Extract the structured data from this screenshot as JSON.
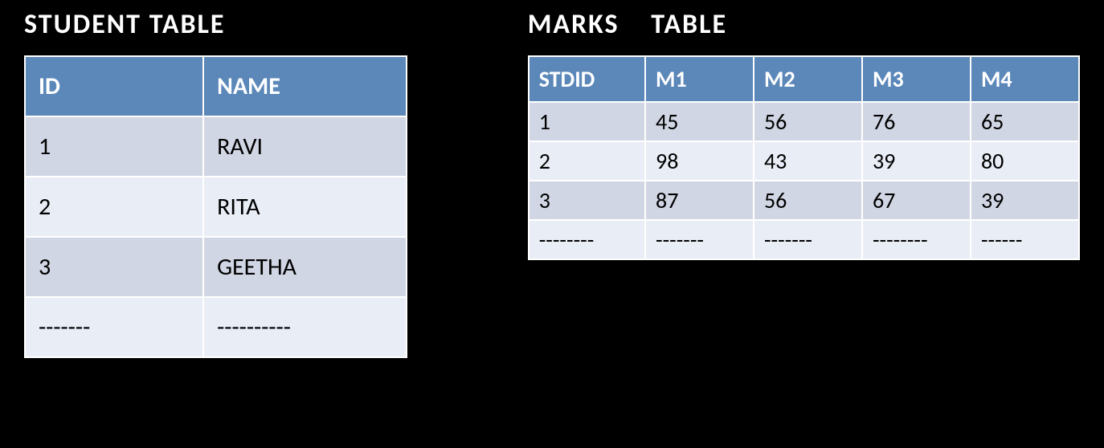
{
  "student_table": {
    "title": "STUDENT  TABLE",
    "headers": [
      "ID",
      "NAME"
    ],
    "rows": [
      [
        "1",
        "RAVI"
      ],
      [
        "2",
        "RITA"
      ],
      [
        "3",
        "GEETHA"
      ],
      [
        "-------",
        "----------"
      ]
    ]
  },
  "marks_table": {
    "title": "MARKS     TABLE",
    "headers": [
      "STDID",
      "M1",
      "M2",
      "M3",
      "M4"
    ],
    "rows": [
      [
        "1",
        "45",
        "56",
        "76",
        "65"
      ],
      [
        "2",
        "98",
        "43",
        "39",
        "80"
      ],
      [
        "3",
        "87",
        "56",
        "67",
        "39"
      ],
      [
        "--------",
        "-------",
        "-------",
        "--------",
        "------"
      ]
    ]
  }
}
